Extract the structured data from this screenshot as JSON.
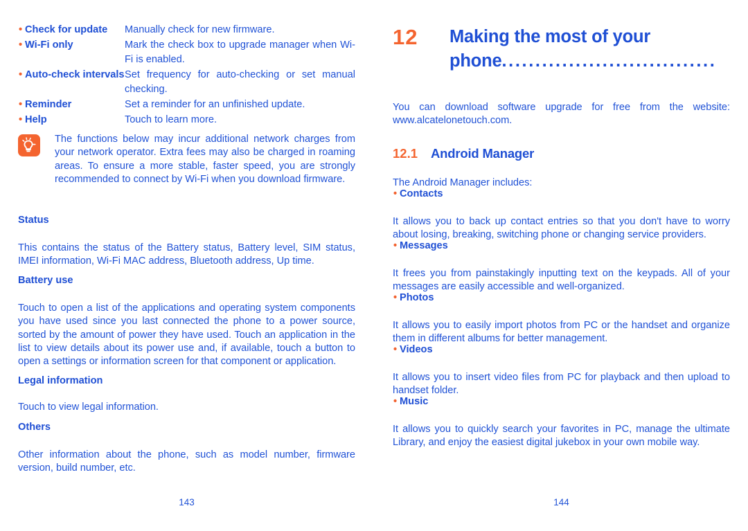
{
  "document": {
    "text_color": "#2052d6",
    "accent_color": "#f4642f",
    "bullet_char": "•"
  },
  "left_page": {
    "folio": "143",
    "settings_list": [
      {
        "label": "Check for update",
        "description": "Manually check for new firmware."
      },
      {
        "label": "Wi-Fi only",
        "description": "Mark the check box to upgrade manager when Wi-Fi is enabled."
      },
      {
        "label": "Auto-check intervals",
        "description": "Set frequency for auto-checking or set manual checking."
      },
      {
        "label": "Reminder",
        "description": "Set a reminder for an unfinished update."
      },
      {
        "label": "Help",
        "description": "Touch to learn more."
      }
    ],
    "note": {
      "icon": "lightbulb-tip-icon",
      "text": "The functions below may incur additional network charges from your network operator. Extra fees may also be charged in roaming areas. To ensure a more stable, faster speed, you are strongly recommended to connect by Wi-Fi when you download firmware."
    },
    "sections": [
      {
        "heading": "Status",
        "body": "This contains the status of the Battery status, Battery level, SIM status, IMEI information, Wi-Fi MAC address, Bluetooth address, Up time."
      },
      {
        "heading": "Battery use",
        "body": "Touch to open a list of the applications and operating system components you have used since you last connected the phone to a power source, sorted by the amount of power they have used. Touch an application in the list to view details about its power use and, if available, touch a button to open a settings or information screen for that component or application."
      },
      {
        "heading": "Legal information",
        "body": "Touch to view legal information."
      },
      {
        "heading": "Others",
        "body": "Other information about the phone, such as model number, firmware version, build number, etc."
      }
    ]
  },
  "right_page": {
    "folio": "144",
    "chapter": {
      "number": "12",
      "title": "Making the most of your phone",
      "leader": "................................"
    },
    "intro": "You can download software upgrade for free from the website: www.alcatelonetouch.com.",
    "section": {
      "number": "12.1",
      "title": "Android Manager",
      "lead_in": "The Android Manager includes:"
    },
    "features": [
      {
        "label": "Contacts",
        "body": "It allows you to back up contact entries so that you don't have to worry about losing, breaking, switching phone or changing service providers."
      },
      {
        "label": "Messages",
        "body": "It frees you from painstakingly inputting text on the keypads. All of your messages are easily accessible and well-organized."
      },
      {
        "label": "Photos",
        "body": "It allows you to easily import photos from PC or the handset and organize them in different albums for better management."
      },
      {
        "label": "Videos",
        "body": "It allows you to insert video files from PC for playback and then upload to handset folder."
      },
      {
        "label": "Music",
        "body": "It allows you to quickly search your favorites in PC, manage the ultimate Library, and enjoy the easiest digital jukebox in your own mobile way."
      }
    ]
  }
}
